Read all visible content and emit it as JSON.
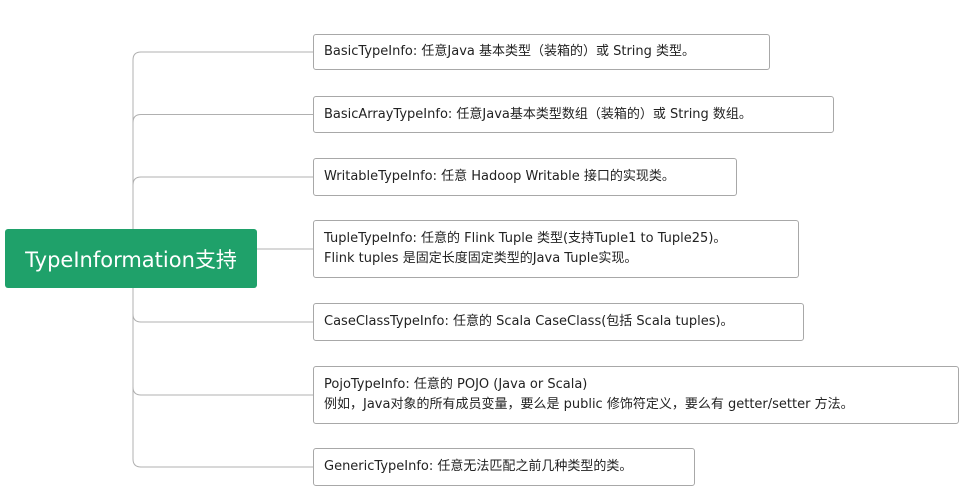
{
  "root": {
    "label": "TypeInformation支持",
    "color": "#1fa16a"
  },
  "branches": [
    {
      "lines": [
        "BasicTypeInfo: 任意Java 基本类型（装箱的）或 String 类型。"
      ]
    },
    {
      "lines": [
        "BasicArrayTypeInfo: 任意Java基本类型数组（装箱的）或 String 数组。"
      ]
    },
    {
      "lines": [
        "WritableTypeInfo: 任意 Hadoop Writable 接口的实现类。"
      ]
    },
    {
      "lines": [
        "TupleTypeInfo: 任意的 Flink Tuple 类型(支持Tuple1 to Tuple25)。",
        "Flink tuples 是固定长度固定类型的Java Tuple实现。"
      ]
    },
    {
      "lines": [
        "CaseClassTypeInfo: 任意的 Scala CaseClass(包括 Scala tuples)。"
      ]
    },
    {
      "lines": [
        "PojoTypeInfo: 任意的 POJO (Java or Scala)",
        "例如，Java对象的所有成员变量，要么是 public 修饰符定义，要么有 getter/setter 方法。"
      ]
    },
    {
      "lines": [
        "GenericTypeInfo: 任意无法匹配之前几种类型的类。"
      ]
    }
  ],
  "connector_color": "#b0b0b0"
}
